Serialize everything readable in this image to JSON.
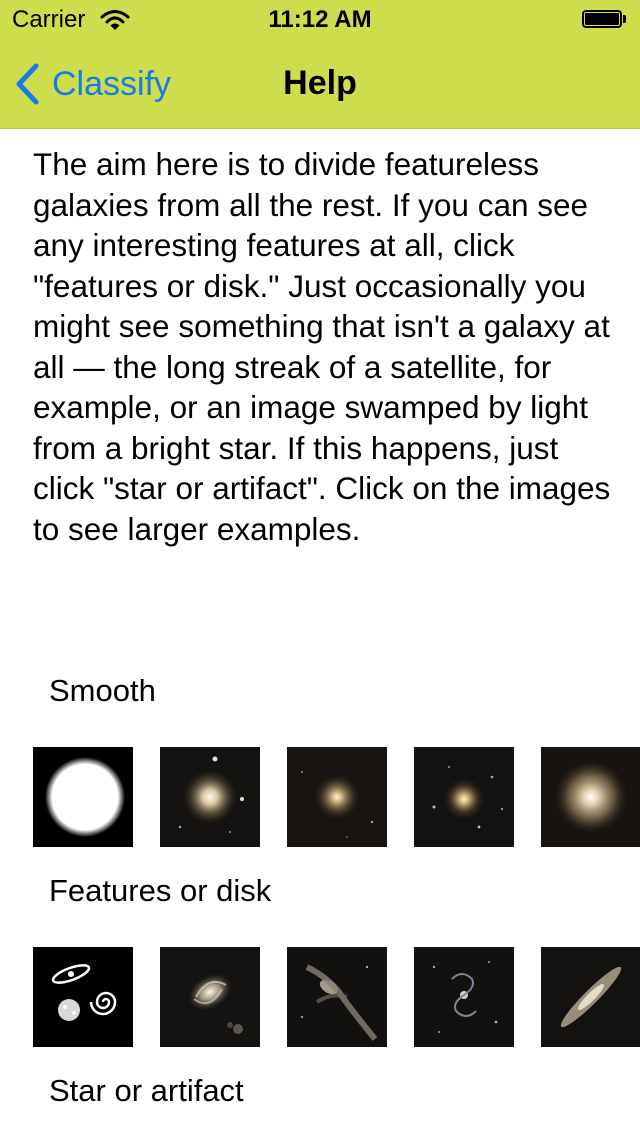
{
  "status_bar": {
    "carrier": "Carrier",
    "time": "11:12 AM"
  },
  "nav": {
    "back_label": "Classify",
    "title": "Help"
  },
  "intro_text": "The aim here is to divide featureless galaxies from all the rest. If you can see any interesting features at all, click \"features or disk.\" Just occasionally you might see something that isn't a galaxy at all — the long streak of a satellite, for example, or an image swamped by light from a bright star. If this happens, just click \"star or artifact\". Click on the images to see larger examples.",
  "sections": [
    {
      "label": "Smooth",
      "thumbnails": [
        "smooth-icon",
        "smooth-example-1",
        "smooth-example-2",
        "smooth-example-3",
        "smooth-example-4"
      ]
    },
    {
      "label": "Features or disk",
      "thumbnails": [
        "features-icon",
        "features-example-1",
        "features-example-2",
        "features-example-3",
        "features-example-4"
      ]
    },
    {
      "label": "Star or artifact",
      "thumbnails": []
    }
  ],
  "colors": {
    "nav_bar": "#cddd4c",
    "link": "#1a7ae8"
  }
}
